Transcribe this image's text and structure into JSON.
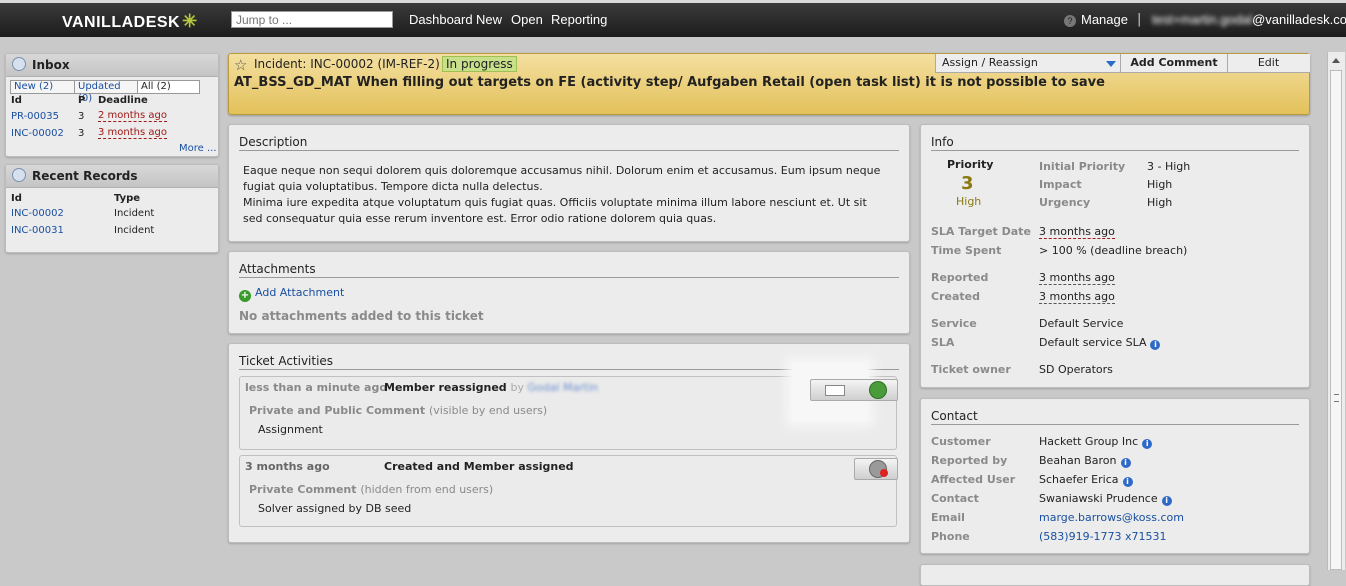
{
  "topbar": {
    "logo": "VANILLADESK",
    "logo_mark": "✳",
    "search_placeholder": "Jump to ...",
    "nav": [
      "Dashboard",
      "New",
      "Open",
      "Reporting"
    ],
    "manage": "Manage",
    "separator": "|",
    "user_hidden": "test+martin.godal",
    "user_domain": "@vanilladesk.com"
  },
  "inbox": {
    "title": "Inbox",
    "tabs": [
      "New (2)",
      "Updated (0)",
      "All (2)"
    ],
    "columns": [
      "Id",
      "P",
      "Deadline"
    ],
    "rows": [
      {
        "id": "PR-00035",
        "p": "3",
        "deadline": "2 months ago"
      },
      {
        "id": "INC-00002",
        "p": "3",
        "deadline": "3 months ago"
      }
    ],
    "more": "More ..."
  },
  "recent": {
    "title": "Recent Records",
    "columns": [
      "Id",
      "Type"
    ],
    "rows": [
      {
        "id": "INC-00002",
        "type": "Incident"
      },
      {
        "id": "INC-00031",
        "type": "Incident"
      }
    ]
  },
  "incident": {
    "id_label": "Incident: INC-00002 (IM-REF-2)",
    "status": "In progress",
    "title": "AT_BSS_GD_MAT When filling out targets on FE (activity step/ Aufgaben Retail (open task list) it is not possible to save",
    "actions": {
      "assign": "Assign / Reassign",
      "add_comment": "Add Comment",
      "edit": "Edit"
    }
  },
  "description": {
    "title": "Description",
    "p1": "Eaque neque non sequi dolorem quis doloremque accusamus nihil. Dolorum enim et accusamus. Eum ipsum neque fugiat quia voluptatibus. Tempore dicta nulla delectus.",
    "p2": "Minima iure expedita atque voluptatum quis fugiat quas. Officiis voluptate minima illum labore nesciunt et. Ut sit sed consequatur quia esse rerum inventore est. Error odio ratione dolorem quia quas."
  },
  "attachments": {
    "title": "Attachments",
    "add": "Add Attachment",
    "empty": "No attachments added to this ticket"
  },
  "activities": {
    "title": "Ticket Activities",
    "items": [
      {
        "time": "less than a minute ago",
        "type": "Member reassigned",
        "by": "by",
        "by_name": "Godal Martin",
        "kind": "Private and Public Comment",
        "kind_note": "(visible by end users)",
        "body": "Assignment"
      },
      {
        "time": "3 months ago",
        "type": "Created and Member assigned",
        "kind": "Private Comment",
        "kind_note": "(hidden from end users)",
        "body": "Solver assigned by DB seed"
      }
    ]
  },
  "info": {
    "title": "Info",
    "priority_label": "Priority",
    "priority_value": "3",
    "priority_text": "High",
    "initial_priority_label": "Initial Priority",
    "initial_priority": "3 - High",
    "impact_label": "Impact",
    "impact": "High",
    "urgency_label": "Urgency",
    "urgency": "High",
    "sla_target_label": "SLA Target Date",
    "sla_target": "3 months ago",
    "time_spent_label": "Time Spent",
    "time_spent": "> 100 % (deadline breach)",
    "reported_label": "Reported",
    "reported": "3 months ago",
    "created_label": "Created",
    "created": "3 months ago",
    "service_label": "Service",
    "service": "Default Service",
    "sla_label": "SLA",
    "sla": "Default service SLA",
    "owner_label": "Ticket owner",
    "owner": "SD Operators"
  },
  "contact": {
    "title": "Contact",
    "customer_label": "Customer",
    "customer": "Hackett Group Inc",
    "reported_by_label": "Reported by",
    "reported_by": "Beahan Baron",
    "affected_label": "Affected User",
    "affected": "Schaefer Erica",
    "contact_label": "Contact",
    "contact": "Swaniawski Prudence",
    "email_label": "Email",
    "email": "marge.barrows@koss.com",
    "phone_label": "Phone",
    "phone": "(583)919-1773 x71531"
  },
  "colors": {
    "status_bg": "#c8e08a",
    "overdue": "#a01818",
    "link": "#1a4fa0",
    "priority": "#8a7a10"
  }
}
